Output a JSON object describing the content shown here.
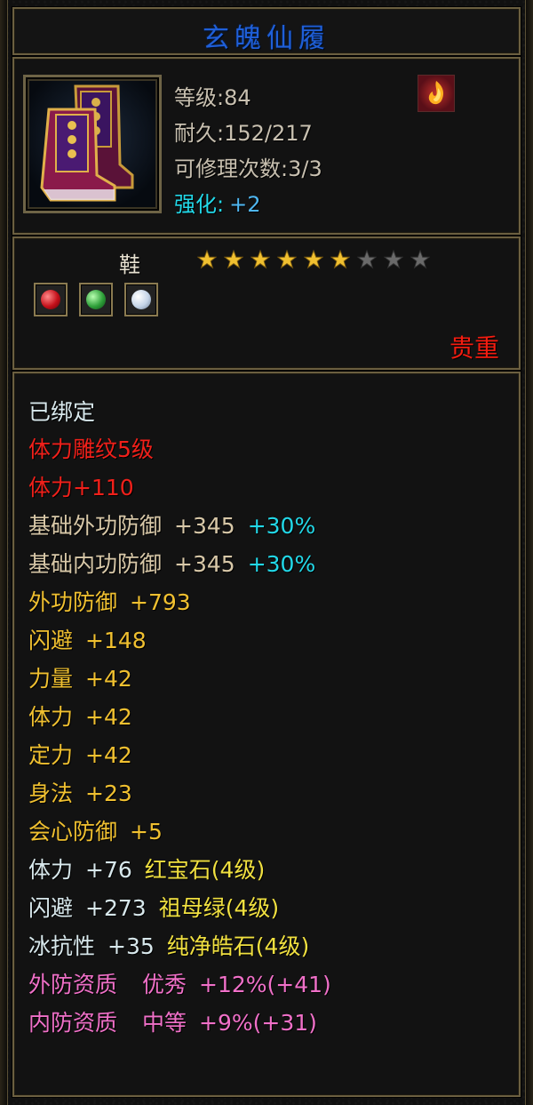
{
  "item": {
    "name": "玄魄仙履",
    "level": "等级:84",
    "durability": "耐久:152/217",
    "repairs": "可修理次数:3/3",
    "enhance_label": "强化:",
    "enhance_value": "+2"
  },
  "type_label": "鞋",
  "stars": {
    "filled": 6,
    "total": 9
  },
  "gems": [
    {
      "name": "ruby-gem"
    },
    {
      "name": "emerald-gem"
    },
    {
      "name": "diamond-gem"
    }
  ],
  "rarity": "贵重",
  "stats": {
    "bound": "已绑定",
    "engrave_name": "体力雕纹5级",
    "engrave_stat": "体力+110",
    "base_outer_def": {
      "label": "基础外功防御",
      "value": "+345",
      "pct": "+30%"
    },
    "base_inner_def": {
      "label": "基础内功防御",
      "value": "+345",
      "pct": "+30%"
    },
    "outer_def": {
      "label": "外功防御",
      "value": "+793"
    },
    "dodge": {
      "label": "闪避",
      "value": "+148"
    },
    "strength": {
      "label": "力量",
      "value": "+42"
    },
    "stamina": {
      "label": "体力",
      "value": "+42"
    },
    "focus": {
      "label": "定力",
      "value": "+42"
    },
    "agility": {
      "label": "身法",
      "value": "+23"
    },
    "crit_def": {
      "label": "会心防御",
      "value": "+5"
    },
    "gem1": {
      "label": "体力",
      "value": "+76",
      "gem": "红宝石(4级)"
    },
    "gem2": {
      "label": "闪避",
      "value": "+273",
      "gem": "祖母绿(4级)"
    },
    "gem3": {
      "label": "冰抗性",
      "value": "+35",
      "gem": "纯净皓石(4级)"
    },
    "quality_outer": {
      "label": "外防资质",
      "grade": "优秀",
      "bonus": "+12%(+41)"
    },
    "quality_inner": {
      "label": "内防资质",
      "grade": "中等",
      "bonus": "+9%(+31)"
    }
  },
  "colors": {
    "title": "#1f5fd8",
    "rarity": "#f41c10",
    "engrave": "#f0201a",
    "base": "#d8c8a8",
    "percent": "#22d8e8",
    "attribute": "#f0c030",
    "gem_name": "#f0e040",
    "quality": "#f070c8"
  }
}
